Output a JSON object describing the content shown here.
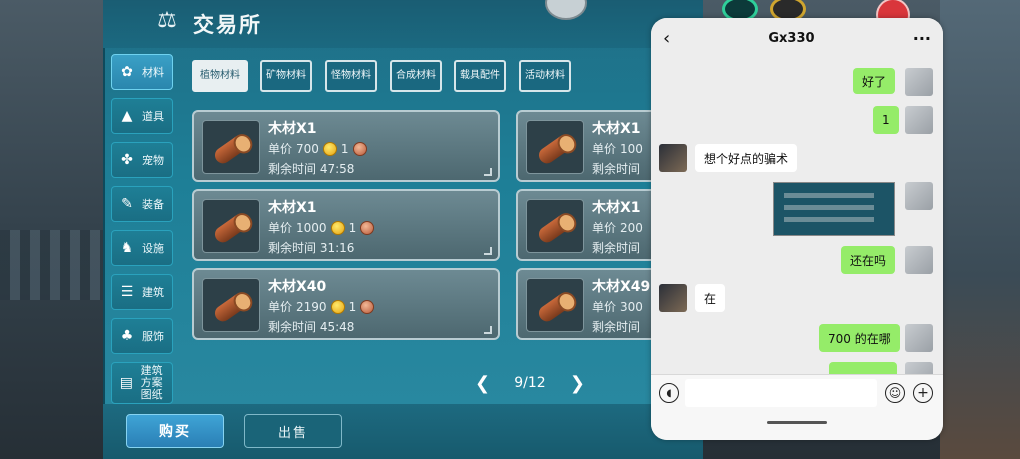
{
  "game": {
    "title": "交易所",
    "sidebar": [
      {
        "label": "材料",
        "icon": "materials-icon",
        "active": true
      },
      {
        "label": "道具",
        "icon": "flask-icon",
        "active": false
      },
      {
        "label": "宠物",
        "icon": "paw-icon",
        "active": false
      },
      {
        "label": "装备",
        "icon": "sword-icon",
        "active": false
      },
      {
        "label": "设施",
        "icon": "facility-icon",
        "active": false
      },
      {
        "label": "建筑",
        "icon": "building-icon",
        "active": false
      },
      {
        "label": "服饰",
        "icon": "clothing-icon",
        "active": false
      },
      {
        "label": "建筑方案图纸",
        "icon": "blueprint-icon",
        "active": false
      }
    ],
    "tabs": [
      {
        "label": "植物材料",
        "active": true
      },
      {
        "label": "矿物材料",
        "active": false
      },
      {
        "label": "怪物材料",
        "active": false
      },
      {
        "label": "合成材料",
        "active": false
      },
      {
        "label": "载具配件",
        "active": false
      },
      {
        "label": "活动材料",
        "active": false
      }
    ],
    "price_label": "单价",
    "time_label": "剩余时间",
    "listings": [
      {
        "name": "木材X1",
        "price": "700",
        "qty": "1",
        "time": "47:58"
      },
      {
        "name": "木材X1",
        "price": "100",
        "qty": "",
        "time": ""
      },
      {
        "name": "木材X1",
        "price": "1000",
        "qty": "1",
        "time": "31:16"
      },
      {
        "name": "木材X1",
        "price": "200",
        "qty": "",
        "time": ""
      },
      {
        "name": "木材X40",
        "price": "2190",
        "qty": "1",
        "time": "45:48"
      },
      {
        "name": "木材X49",
        "price": "300",
        "qty": "",
        "time": ""
      }
    ],
    "pager": {
      "text": "9/12",
      "current": 9,
      "total": 12
    },
    "buy_label": "购买",
    "sell_label": "出售"
  },
  "chat": {
    "title": "Gx330",
    "messages": [
      {
        "from": "me",
        "text": "好了"
      },
      {
        "from": "me",
        "text": "1"
      },
      {
        "from": "other",
        "text": "想个好点的骗术"
      },
      {
        "from": "me",
        "text": "[image]"
      },
      {
        "from": "me",
        "text": "还在吗"
      },
      {
        "from": "other",
        "text": "在"
      },
      {
        "from": "me",
        "text": "700 的在哪"
      }
    ]
  },
  "colors": {
    "accent": "#2a86ad",
    "chat_green": "#95ec69"
  }
}
